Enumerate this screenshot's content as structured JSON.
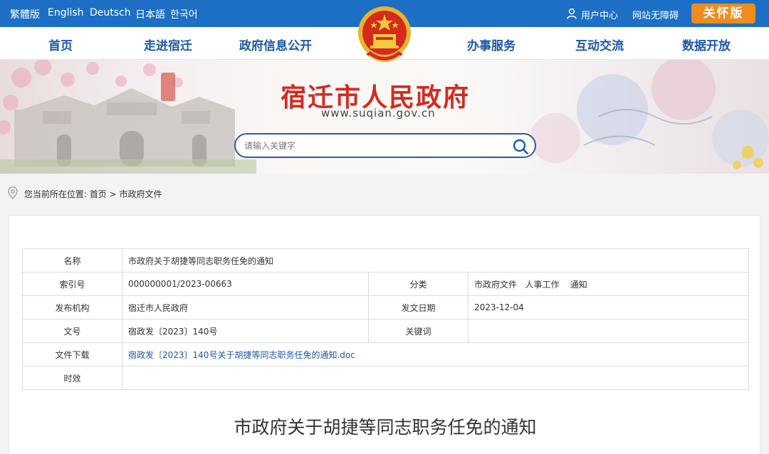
{
  "topbar": {
    "languages": [
      "繁體版",
      "English",
      "Deutsch",
      "日本語",
      "한국어"
    ],
    "user_center": "用户中心",
    "accessibility": "网站无障碍",
    "care_mode": "关怀版"
  },
  "nav": {
    "items": [
      "首页",
      "走进宿迁",
      "政府信息公开",
      "办事服务",
      "互动交流",
      "数据开放"
    ]
  },
  "banner": {
    "title": "宿迁市人民政府",
    "url": "www.suqian.gov.cn",
    "search_placeholder": "请输入关键字"
  },
  "breadcrumb": {
    "prefix": "您当前所在位置:",
    "home": "首页",
    "separator": ">",
    "current": "市政府文件"
  },
  "meta": {
    "name_label": "名称",
    "name_value": "市政府关于胡捷等同志职务任免的通知",
    "index_label": "索引号",
    "index_value": "000000001/2023-00663",
    "category_label": "分类",
    "category_value": "市政府文件   人事工作    通知",
    "issuer_label": "发布机构",
    "issuer_value": "宿迁市人民政府",
    "date_label": "发文日期",
    "date_value": "2023-12-04",
    "docno_label": "文号",
    "docno_value": "宿政发〔2023〕140号",
    "keywords_label": "关键词",
    "keywords_value": "",
    "download_label": "文件下载",
    "download_value": "宿政发〔2023〕140号关于胡捷等同志职务任免的通知.doc",
    "validity_label": "时效",
    "validity_value": ""
  },
  "article": {
    "title": "市政府关于胡捷等同志职务任免的通知"
  },
  "colors": {
    "brand_blue": "#1c6fc4",
    "nav_text": "#1c57a8",
    "title_red": "#d22b1f",
    "care_orange": "#f08c1e"
  }
}
